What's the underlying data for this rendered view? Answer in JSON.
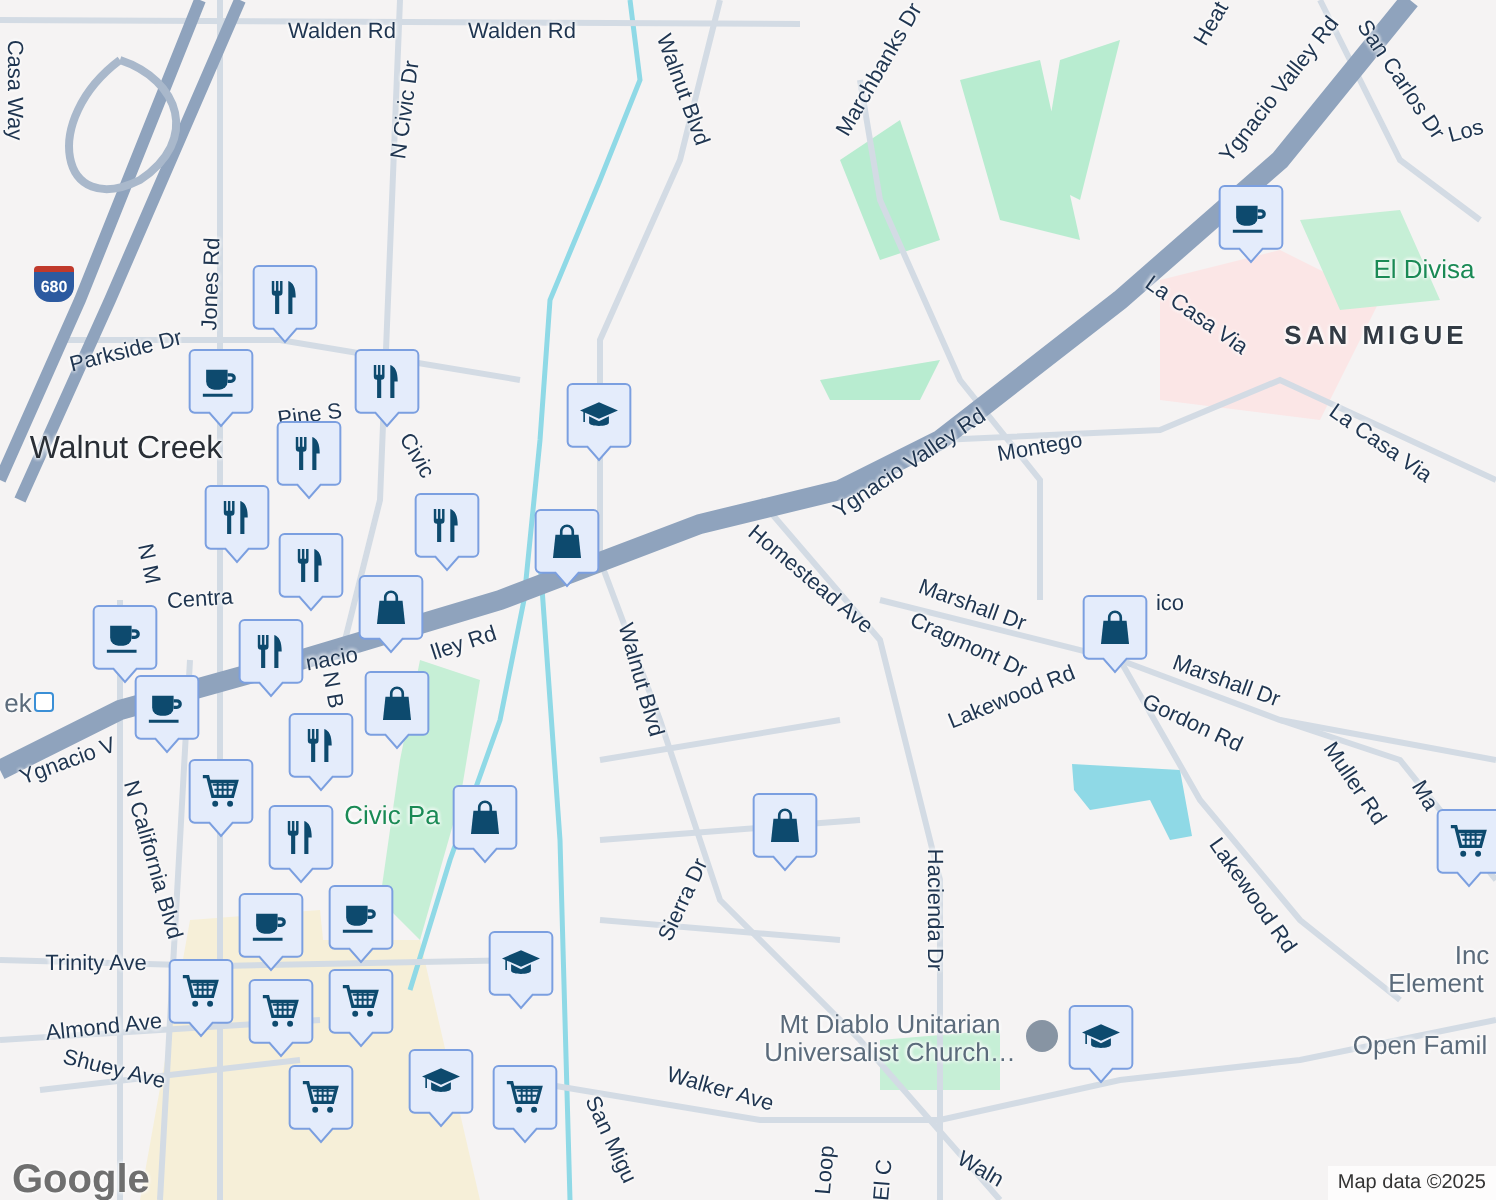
{
  "map": {
    "labels": [
      {
        "text": "Walden Rd",
        "kind": "street"
      },
      {
        "text": "Walden Rd",
        "kind": "street"
      },
      {
        "text": "Casa Way",
        "kind": "street"
      },
      {
        "text": "N Civic Dr",
        "kind": "street"
      },
      {
        "text": "Walnut Blvd",
        "kind": "street"
      },
      {
        "text": "Marchbanks Dr",
        "kind": "street"
      },
      {
        "text": "Heat",
        "kind": "street"
      },
      {
        "text": "Ygnacio Valley Rd",
        "kind": "street"
      },
      {
        "text": "San Carlos Dr",
        "kind": "street"
      },
      {
        "text": "Los",
        "kind": "street"
      },
      {
        "text": "El Divisa",
        "kind": "park"
      },
      {
        "text": "Jones Rd",
        "kind": "street"
      },
      {
        "text": "La Casa Via",
        "kind": "street"
      },
      {
        "text": "SAN MIGUE",
        "kind": "district"
      },
      {
        "text": "Parkside Dr",
        "kind": "street"
      },
      {
        "text": "Pine S",
        "kind": "street"
      },
      {
        "text": "Walnut Creek",
        "kind": "city"
      },
      {
        "text": "Civic",
        "kind": "street"
      },
      {
        "text": "La Casa Via",
        "kind": "street"
      },
      {
        "text": "Montego",
        "kind": "street"
      },
      {
        "text": "Ygnacio Valley Rd",
        "kind": "street"
      },
      {
        "text": "N M",
        "kind": "street"
      },
      {
        "text": "Homestead Ave",
        "kind": "street"
      },
      {
        "text": "Marshall Dr",
        "kind": "street"
      },
      {
        "text": "ico",
        "kind": "street"
      },
      {
        "text": "Centra",
        "kind": "street"
      },
      {
        "text": "nacio",
        "kind": "street"
      },
      {
        "text": "lley Rd",
        "kind": "street"
      },
      {
        "text": "Cragmont Dr",
        "kind": "street"
      },
      {
        "text": "Walnut Blvd",
        "kind": "street"
      },
      {
        "text": "Lakewood Rd",
        "kind": "street"
      },
      {
        "text": "Marshall Dr",
        "kind": "street"
      },
      {
        "text": "ek",
        "kind": "poi"
      },
      {
        "text": "N B",
        "kind": "street"
      },
      {
        "text": "Gordon Rd",
        "kind": "street"
      },
      {
        "text": "Ygnacio V",
        "kind": "street"
      },
      {
        "text": "Muller Rd",
        "kind": "street"
      },
      {
        "text": "Ma",
        "kind": "street"
      },
      {
        "text": "Civic Pa",
        "kind": "park"
      },
      {
        "text": "N California Blvd",
        "kind": "street"
      },
      {
        "text": "Sierra Dr",
        "kind": "street"
      },
      {
        "text": "Hacienda Dr",
        "kind": "street"
      },
      {
        "text": "Lakewood Rd",
        "kind": "street"
      },
      {
        "text": "Inc",
        "kind": "poi"
      },
      {
        "text": "Trinity Ave",
        "kind": "street"
      },
      {
        "text": "Element",
        "kind": "poi"
      },
      {
        "text": "Almond Ave",
        "kind": "street"
      },
      {
        "text": "Mt Diablo Unitarian Universalist Church…",
        "kind": "poi"
      },
      {
        "text": "Open Famil",
        "kind": "poi"
      },
      {
        "text": "Shuey Ave",
        "kind": "street"
      },
      {
        "text": "Walker Ave",
        "kind": "street"
      },
      {
        "text": "San Migu",
        "kind": "street"
      },
      {
        "text": "Loop",
        "kind": "street"
      },
      {
        "text": "El C",
        "kind": "street"
      },
      {
        "text": "Waln",
        "kind": "street"
      }
    ],
    "pins": [
      {
        "kind": "cafe"
      },
      {
        "kind": "restaurant"
      },
      {
        "kind": "cafe"
      },
      {
        "kind": "restaurant"
      },
      {
        "kind": "school"
      },
      {
        "kind": "restaurant"
      },
      {
        "kind": "restaurant"
      },
      {
        "kind": "restaurant"
      },
      {
        "kind": "shop"
      },
      {
        "kind": "restaurant"
      },
      {
        "kind": "shop"
      },
      {
        "kind": "cafe"
      },
      {
        "kind": "restaurant"
      },
      {
        "kind": "shop"
      },
      {
        "kind": "shop"
      },
      {
        "kind": "cafe"
      },
      {
        "kind": "restaurant"
      },
      {
        "kind": "restaurant"
      },
      {
        "kind": "grocery"
      },
      {
        "kind": "shop"
      },
      {
        "kind": "shop"
      },
      {
        "kind": "grocery"
      },
      {
        "kind": "cafe"
      },
      {
        "kind": "cafe"
      },
      {
        "kind": "grocery"
      },
      {
        "kind": "grocery"
      },
      {
        "kind": "grocery"
      },
      {
        "kind": "school"
      },
      {
        "kind": "grocery"
      },
      {
        "kind": "school"
      },
      {
        "kind": "grocery"
      },
      {
        "kind": "school"
      }
    ],
    "highway_shield": "680",
    "logo": "Google",
    "attribution": "Map data ©2025"
  }
}
